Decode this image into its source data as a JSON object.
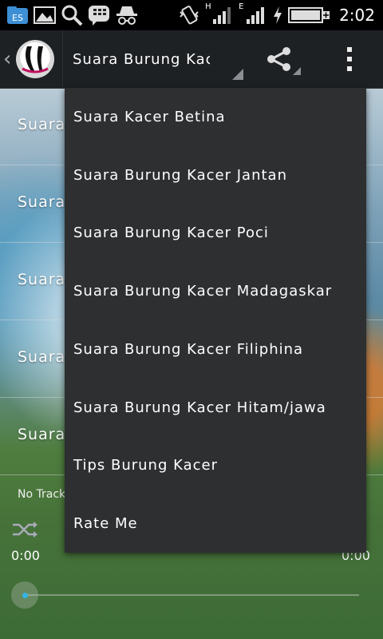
{
  "status_bar": {
    "time": "2:02",
    "signal_h": "H",
    "signal_e": "E",
    "icons": [
      "es-file-icon",
      "gallery-icon",
      "search-icon",
      "bbm-icon",
      "incognito-icon",
      "vibrate-icon",
      "signal-icon",
      "charging-icon",
      "battery-icon"
    ]
  },
  "action_bar": {
    "title": "Suara Burung Kacer Betina",
    "icons": [
      "app-logo-icon",
      "share-icon",
      "overflow-icon"
    ]
  },
  "list": {
    "items": [
      {
        "label": "Suara Kacer Betina"
      },
      {
        "label": "Suara Burung Kacer Jantan"
      },
      {
        "label": "Suara Burung Kacer Poci"
      },
      {
        "label": "Suara Burung Kacer Madagaskar"
      },
      {
        "label": "Suara Burung Kacer Filiphina"
      }
    ]
  },
  "player": {
    "track": "No Track",
    "time_current": "0:00",
    "time_total": "0:00",
    "progress": 0
  },
  "menu": {
    "items": [
      {
        "label": "Suara Kacer Betina"
      },
      {
        "label": "Suara Burung Kacer Jantan"
      },
      {
        "label": "Suara Burung Kacer Poci"
      },
      {
        "label": "Suara Burung Kacer Madagaskar"
      },
      {
        "label": "Suara Burung Kacer Filiphina"
      },
      {
        "label": "Suara Burung Kacer Hitam/jawa"
      },
      {
        "label": "Tips Burung Kacer"
      },
      {
        "label": "Rate Me"
      }
    ]
  },
  "colors": {
    "menu_bg": "#2e2f31",
    "action_bar_bg": "#1e2124",
    "accent": "#33b5e5"
  }
}
